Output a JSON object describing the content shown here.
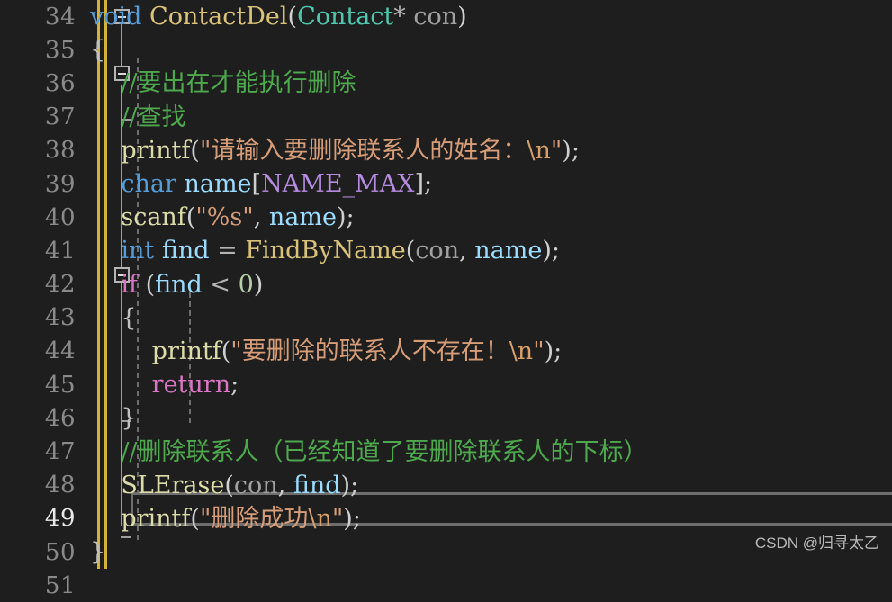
{
  "editor": {
    "theme_background": "#1e1e1e",
    "default_text_color": "#d4d4d4",
    "active_line_number": "49",
    "first_visible_line": "34",
    "last_visible_line": "51"
  },
  "watermark": {
    "text": "CSDN @归寻太乙"
  },
  "lines": [
    {
      "number": "34",
      "tokens": [
        {
          "t": "void",
          "c": "kw"
        },
        {
          "t": " ",
          "c": "punc"
        },
        {
          "t": "ContactDel",
          "c": "fndef"
        },
        {
          "t": "(",
          "c": "punc"
        },
        {
          "t": "Contact",
          "c": "type"
        },
        {
          "t": "*",
          "c": "op"
        },
        {
          "t": " ",
          "c": "punc"
        },
        {
          "t": "con",
          "c": "param"
        },
        {
          "t": ")",
          "c": "punc"
        }
      ]
    },
    {
      "number": "35",
      "tokens": [
        {
          "t": "{",
          "c": "brace"
        }
      ]
    },
    {
      "number": "36",
      "tokens": [
        {
          "t": "    //要出在才能执行删除",
          "c": "cmt"
        }
      ]
    },
    {
      "number": "37",
      "tokens": [
        {
          "t": "    //查找",
          "c": "cmt"
        }
      ]
    },
    {
      "number": "38",
      "tokens": [
        {
          "t": "    ",
          "c": "punc"
        },
        {
          "t": "printf",
          "c": "fn"
        },
        {
          "t": "(",
          "c": "punc"
        },
        {
          "t": "\"请输入要删除联系人的姓名：",
          "c": "str"
        },
        {
          "t": "\\n",
          "c": "esc"
        },
        {
          "t": "\"",
          "c": "str"
        },
        {
          "t": ")",
          "c": "punc"
        },
        {
          "t": ";",
          "c": "punc"
        }
      ]
    },
    {
      "number": "39",
      "tokens": [
        {
          "t": "    ",
          "c": "punc"
        },
        {
          "t": "char",
          "c": "kw"
        },
        {
          "t": " ",
          "c": "punc"
        },
        {
          "t": "name",
          "c": "var"
        },
        {
          "t": "[",
          "c": "punc"
        },
        {
          "t": "NAME_MAX",
          "c": "macro"
        },
        {
          "t": "]",
          "c": "punc"
        },
        {
          "t": ";",
          "c": "punc"
        }
      ]
    },
    {
      "number": "40",
      "tokens": [
        {
          "t": "    ",
          "c": "punc"
        },
        {
          "t": "scanf",
          "c": "fn"
        },
        {
          "t": "(",
          "c": "punc"
        },
        {
          "t": "\"%s\"",
          "c": "str"
        },
        {
          "t": ", ",
          "c": "punc"
        },
        {
          "t": "name",
          "c": "var"
        },
        {
          "t": ")",
          "c": "punc"
        },
        {
          "t": ";",
          "c": "punc"
        }
      ]
    },
    {
      "number": "41",
      "tokens": [
        {
          "t": "    ",
          "c": "punc"
        },
        {
          "t": "int",
          "c": "kw"
        },
        {
          "t": " ",
          "c": "punc"
        },
        {
          "t": "find",
          "c": "var"
        },
        {
          "t": " ",
          "c": "punc"
        },
        {
          "t": "=",
          "c": "op"
        },
        {
          "t": " ",
          "c": "punc"
        },
        {
          "t": "FindByName",
          "c": "fndef"
        },
        {
          "t": "(",
          "c": "punc"
        },
        {
          "t": "con",
          "c": "param"
        },
        {
          "t": ", ",
          "c": "punc"
        },
        {
          "t": "name",
          "c": "var"
        },
        {
          "t": ")",
          "c": "punc"
        },
        {
          "t": ";",
          "c": "punc"
        }
      ]
    },
    {
      "number": "42",
      "tokens": [
        {
          "t": "    ",
          "c": "punc"
        },
        {
          "t": "if",
          "c": "kwctl"
        },
        {
          "t": " (",
          "c": "punc"
        },
        {
          "t": "find",
          "c": "var"
        },
        {
          "t": " ",
          "c": "punc"
        },
        {
          "t": "<",
          "c": "op"
        },
        {
          "t": " ",
          "c": "punc"
        },
        {
          "t": "0",
          "c": "num"
        },
        {
          "t": ")",
          "c": "punc"
        }
      ]
    },
    {
      "number": "43",
      "tokens": [
        {
          "t": "    ",
          "c": "punc"
        },
        {
          "t": "{",
          "c": "brace"
        }
      ]
    },
    {
      "number": "44",
      "tokens": [
        {
          "t": "        ",
          "c": "punc"
        },
        {
          "t": "printf",
          "c": "fn"
        },
        {
          "t": "(",
          "c": "punc"
        },
        {
          "t": "\"要删除的联系人不存在！",
          "c": "str"
        },
        {
          "t": "\\n",
          "c": "esc"
        },
        {
          "t": "\"",
          "c": "str"
        },
        {
          "t": ")",
          "c": "punc"
        },
        {
          "t": ";",
          "c": "punc"
        }
      ]
    },
    {
      "number": "45",
      "tokens": [
        {
          "t": "        ",
          "c": "punc"
        },
        {
          "t": "return",
          "c": "kwctl"
        },
        {
          "t": ";",
          "c": "punc"
        }
      ]
    },
    {
      "number": "46",
      "tokens": [
        {
          "t": "    ",
          "c": "punc"
        },
        {
          "t": "}",
          "c": "brace"
        }
      ]
    },
    {
      "number": "47",
      "tokens": [
        {
          "t": "    //删除联系人（已经知道了要删除联系人的下标）",
          "c": "cmt"
        }
      ]
    },
    {
      "number": "48",
      "tokens": [
        {
          "t": "    ",
          "c": "punc"
        },
        {
          "t": "SLErase",
          "c": "fn"
        },
        {
          "t": "(",
          "c": "punc"
        },
        {
          "t": "con",
          "c": "param"
        },
        {
          "t": ", ",
          "c": "punc"
        },
        {
          "t": "find",
          "c": "var"
        },
        {
          "t": ")",
          "c": "punc"
        },
        {
          "t": ";",
          "c": "punc"
        }
      ]
    },
    {
      "number": "49",
      "active": true,
      "tokens": [
        {
          "t": "    ",
          "c": "punc"
        },
        {
          "t": "printf",
          "c": "fn"
        },
        {
          "t": "(",
          "c": "punc"
        },
        {
          "t": "\"删除成功",
          "c": "str"
        },
        {
          "t": "\\n",
          "c": "esc"
        },
        {
          "t": "\"",
          "c": "str"
        },
        {
          "t": ")",
          "c": "punc"
        },
        {
          "t": ";",
          "c": "punc"
        }
      ]
    },
    {
      "number": "50",
      "tokens": [
        {
          "t": "}",
          "c": "brace"
        }
      ]
    },
    {
      "number": "51",
      "tokens": []
    }
  ],
  "fold_markers": [
    {
      "line": "34",
      "state": "expanded"
    },
    {
      "line": "36",
      "state": "expanded"
    },
    {
      "line": "42",
      "state": "expanded"
    }
  ],
  "colors": {
    "background": "#1e1e1e",
    "keyword": "#569cd6",
    "control_keyword": "#d977c4",
    "function": "#dcdcaa",
    "function_def": "#d9c27a",
    "type": "#4ec9b0",
    "variable": "#9cdcfe",
    "parameter": "#a0a0a0",
    "macro": "#b58ce0",
    "string": "#d69d78",
    "escape": "#d7a06a",
    "number": "#b5cea8",
    "comment": "#4ea84e",
    "line_number": "#8a8a8a",
    "change_bar": "#d4b33a",
    "current_line_border": "#6e6e6e",
    "indent_guide": "#6e6e6e"
  }
}
